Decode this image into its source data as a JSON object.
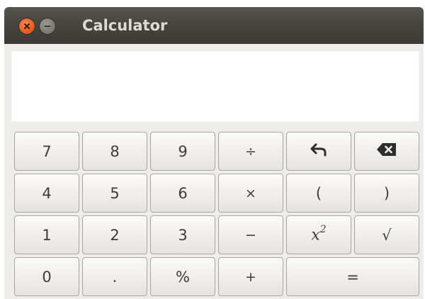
{
  "window": {
    "title": "Calculator",
    "close_icon": "close-icon",
    "minimize_icon": "minimize-icon",
    "colors": {
      "titlebar": "#3c3b37",
      "close": "#e75d1d",
      "minimize": "#7d7c77",
      "title_text": "#dfdbd2"
    }
  },
  "display": {
    "value": ""
  },
  "keypad": {
    "rows": [
      [
        {
          "label": "7"
        },
        {
          "label": "8"
        },
        {
          "label": "9"
        },
        {
          "label": "÷"
        },
        {
          "icon": "undo-icon"
        },
        {
          "icon": "backspace-icon"
        }
      ],
      [
        {
          "label": "4"
        },
        {
          "label": "5"
        },
        {
          "label": "6"
        },
        {
          "label": "×"
        },
        {
          "label": "("
        },
        {
          "label": ")"
        }
      ],
      [
        {
          "label": "1"
        },
        {
          "label": "2"
        },
        {
          "label": "3"
        },
        {
          "label": "−"
        },
        {
          "label": "x",
          "superscript": "2"
        },
        {
          "label": "√"
        }
      ],
      [
        {
          "label": "0"
        },
        {
          "label": "."
        },
        {
          "label": "%"
        },
        {
          "label": "+"
        },
        {
          "label": "="
        }
      ]
    ]
  }
}
